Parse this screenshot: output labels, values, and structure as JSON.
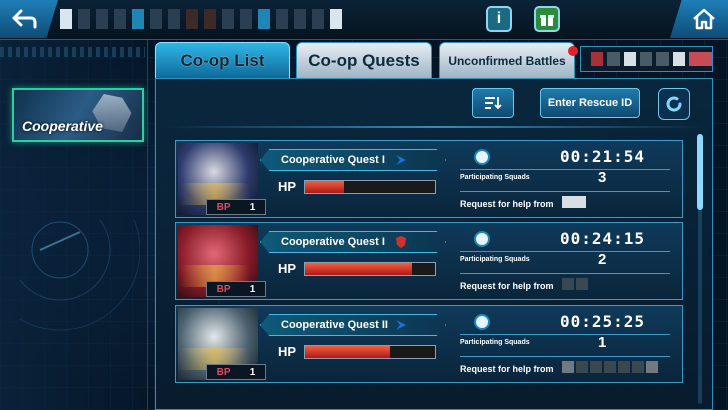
{
  "tabs": [
    {
      "label": "Co-op List",
      "active": true
    },
    {
      "label": "Co-op Quests",
      "active": false
    },
    {
      "label": "Unconfirmed Battles",
      "active": false
    }
  ],
  "left_panel": {
    "card_label": "Cooperative"
  },
  "toolbar": {
    "rescue_label": "Enter Rescue ID"
  },
  "quests": [
    {
      "name": "Cooperative Quest I",
      "faction_color": "#1f6fd0",
      "hp_label": "HP",
      "hp_fraction": 0.3,
      "bp_label": "BP",
      "bp_value": "1",
      "timer": "00:21:54",
      "squads_label": "Participating Squads",
      "squads_value": "3",
      "help_label": "Request for help from"
    },
    {
      "name": "Cooperative Quest I",
      "faction_color": "#d03030",
      "hp_label": "HP",
      "hp_fraction": 0.82,
      "bp_label": "BP",
      "bp_value": "1",
      "timer": "00:24:15",
      "squads_label": "Participating Squads",
      "squads_value": "2",
      "help_label": "Request for help from"
    },
    {
      "name": "Cooperative Quest II",
      "faction_color": "#1f6fd0",
      "hp_label": "HP",
      "hp_fraction": 0.65,
      "bp_label": "BP",
      "bp_value": "1",
      "timer": "00:25:25",
      "squads_label": "Participating Squads",
      "squads_value": "1",
      "help_label": "Request for help from"
    }
  ],
  "colors": {
    "accent": "#2fb6e6",
    "hp_fill": "#e04030",
    "alert": "#e0202a"
  }
}
